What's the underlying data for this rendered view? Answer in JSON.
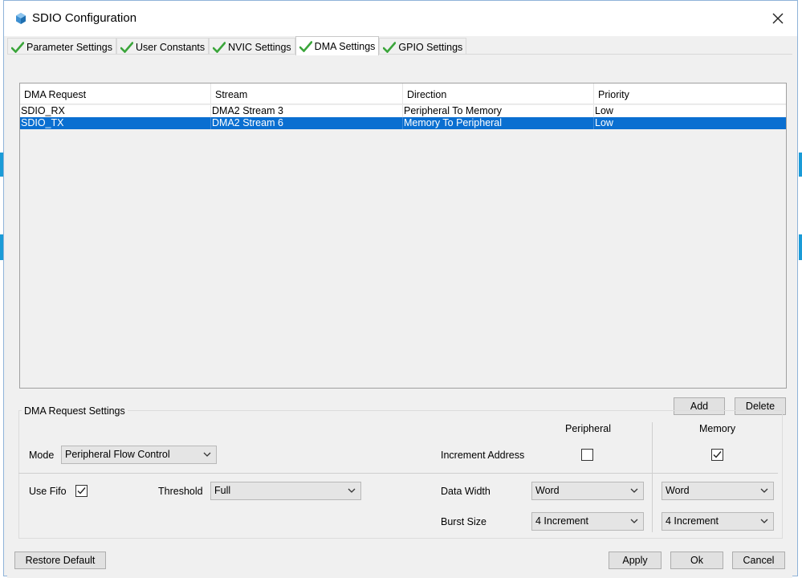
{
  "window": {
    "title": "SDIO Configuration"
  },
  "tabs": [
    {
      "label": "Parameter Settings",
      "active": false
    },
    {
      "label": "User Constants",
      "active": false
    },
    {
      "label": "NVIC Settings",
      "active": false
    },
    {
      "label": "DMA Settings",
      "active": true
    },
    {
      "label": "GPIO Settings",
      "active": false
    }
  ],
  "table": {
    "columns": [
      "DMA Request",
      "Stream",
      "Direction",
      "Priority"
    ],
    "rows": [
      {
        "request": "SDIO_RX",
        "stream": "DMA2 Stream 3",
        "direction": "Peripheral To Memory",
        "priority": "Low",
        "selected": false
      },
      {
        "request": "SDIO_TX",
        "stream": "DMA2 Stream 6",
        "direction": "Memory To Peripheral",
        "priority": "Low",
        "selected": true
      }
    ]
  },
  "table_buttons": {
    "add": "Add",
    "delete": "Delete"
  },
  "settings": {
    "group_title": "DMA Request Settings",
    "peripheral_header": "Peripheral",
    "memory_header": "Memory",
    "mode_label": "Mode",
    "mode_value": "Peripheral Flow Control",
    "increment_label": "Increment Address",
    "peripheral_increment": false,
    "memory_increment": true,
    "use_fifo_label": "Use Fifo",
    "use_fifo": true,
    "threshold_label": "Threshold",
    "threshold_value": "Full",
    "data_width_label": "Data Width",
    "peripheral_data_width": "Word",
    "memory_data_width": "Word",
    "burst_size_label": "Burst Size",
    "peripheral_burst": "4 Increment",
    "memory_burst": "4 Increment"
  },
  "footer": {
    "restore": "Restore Default",
    "apply": "Apply",
    "ok": "Ok",
    "cancel": "Cancel"
  },
  "colors": {
    "selection": "#0a6fd1",
    "check_green": "#3aa53a",
    "window_border": "#8fb3d9"
  }
}
